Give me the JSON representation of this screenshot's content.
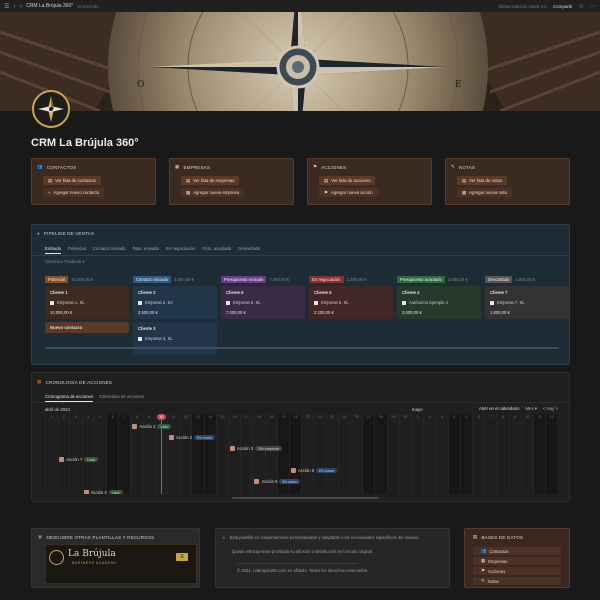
{
  "topbar": {
    "title": "CRM La Brújula 360°",
    "subtitle": "Empezada",
    "edited": "Última edición: Hace 4 h",
    "share": "Compartir"
  },
  "page": {
    "title": "CRM La Brújula 360°"
  },
  "quick": [
    {
      "title": "CONTACTOS",
      "btn1": "Ver lista de contactos",
      "btn2": "Agregar nuevo contacto",
      "icon": "contacts-icon"
    },
    {
      "title": "EMPRESAS",
      "btn1": "Ver lista de empresas",
      "btn2": "Agregar nueva empresa",
      "icon": "building-icon"
    },
    {
      "title": "ACCIONES",
      "btn1": "Ver lista de acciones",
      "btn2": "Agregar nueva acción",
      "icon": "flag-icon"
    },
    {
      "title": "NOTAS",
      "btn1": "Ver lista de notas",
      "btn2": "Agregar nueva nota",
      "icon": "note-icon"
    }
  ],
  "pipeline": {
    "title": "PIPELINE DE VENTAS",
    "tabs": [
      "Embudo",
      "Potencial",
      "Contacto iniciado",
      "Ppto. enviado",
      "En negociación",
      "Ppto. aceptado",
      "Descartado"
    ],
    "filter": "Servicio ▸ Producto ▾",
    "columns": [
      {
        "name": "Potencial",
        "amount": "10.000,00 €",
        "color": "#8a4e1f",
        "bg": "#3d2b1f",
        "cards": [
          {
            "title": "Cliente 1",
            "company": "Empresa 1, SL",
            "value": "10.000,00 €"
          }
        ],
        "new_label": "Nuevo contacto"
      },
      {
        "name": "Contacto iniciado",
        "amount": "4.500,00 €",
        "color": "#2c5b86",
        "bg": "#22364a",
        "cards": [
          {
            "title": "Cliente 2",
            "company": "Empresa 2, SA",
            "value": "2.500,00 €"
          },
          {
            "title": "Cliente 3",
            "company": "Empresa 3, SL",
            "value": ""
          }
        ]
      },
      {
        "name": "Presupuesto enviado",
        "amount": "7.000,00 €",
        "color": "#6b3a8a",
        "bg": "#3a2a45",
        "cards": [
          {
            "title": "Cliente 6",
            "company": "Empresa 6, SL",
            "value": "7.000,00 €"
          }
        ]
      },
      {
        "name": "En negociación",
        "amount": "2.200,00 €",
        "color": "#8a2d2d",
        "bg": "#432726",
        "cards": [
          {
            "title": "Cliente 5",
            "company": "Empresa 5, SL",
            "value": "2.200,00 €"
          }
        ]
      },
      {
        "name": "Presupuesto aceptado",
        "amount": "3.000,00 €",
        "color": "#2e6b3c",
        "bg": "#263a2c",
        "cards": [
          {
            "title": "Cliente 4",
            "company": "Autónomo Ejemplo 4",
            "value": "3.000,00 €"
          }
        ]
      },
      {
        "name": "Descartado",
        "amount": "1.800,00 €",
        "color": "#555555",
        "bg": "#333333",
        "cards": [
          {
            "title": "Cliente 7",
            "company": "Empresa 7, SL",
            "value": "1.800,00 €"
          }
        ]
      }
    ]
  },
  "timeline": {
    "title": "CRONOLOGÍA DE ACCIONES",
    "tabs": [
      "Cronograma de acciones",
      "Calendario de acciones"
    ],
    "month1": "abril de 2024",
    "month2": "mayo",
    "open_label": "Abrir en el calendario",
    "range": "Mes ▾",
    "nav": "< Hoy >",
    "days": [
      "1",
      "2",
      "3",
      "4",
      "5",
      "6",
      "7",
      "8",
      "9",
      "10",
      "11",
      "12",
      "13",
      "14",
      "15",
      "16",
      "17",
      "18",
      "19",
      "20",
      "21",
      "22",
      "23",
      "24",
      "25",
      "26",
      "27",
      "28",
      "29",
      "30",
      "1",
      "2",
      "3",
      "4",
      "5",
      "6",
      "7",
      "8",
      "9",
      "10",
      "11",
      "12"
    ],
    "weekend_index": [
      5,
      6,
      12,
      13,
      19,
      20,
      26,
      27,
      33,
      34,
      40,
      41
    ],
    "today_index": 9,
    "events": [
      {
        "label": "Acción 2",
        "status": "Listo",
        "kind": "listo",
        "day": 7,
        "row": 0
      },
      {
        "label": "Acción 2",
        "status": "En curso",
        "kind": "curso",
        "day": 10,
        "row": 1
      },
      {
        "label": "Acción 3",
        "status": "Sin empezar",
        "kind": "sin",
        "day": 15,
        "row": 2
      },
      {
        "label": "Acción 7",
        "status": "Listo",
        "kind": "listo",
        "day": 1,
        "row": 3
      },
      {
        "label": "Acción 6",
        "status": "En curso",
        "kind": "curso",
        "day": 20,
        "row": 4
      },
      {
        "label": "Acción 5",
        "status": "En curso",
        "kind": "curso",
        "day": 17,
        "row": 5
      },
      {
        "label": "Acción 4",
        "status": "Listo",
        "kind": "listo",
        "day": 3,
        "row": 6
      }
    ]
  },
  "bottom": {
    "discover_title": "DESCUBRE OTRAS PLANTILLAS Y RECURSOS",
    "brand": "La Brújula",
    "brand_sub": "BUSINESS ACADEMY",
    "notice1": "Esta plantilla es completamente personalizable y adaptable a las necesidades específicas del usuario.",
    "notice2": "Queda estrictamente prohibida su difusión o distribución en formato original.",
    "footer": "© 2024, LaBrujula360.com es afiliado. Todos los derechos reservados.",
    "db_title": "BASES DE DATOS",
    "db_items": [
      "Contactos",
      "Empresas",
      "Acciones",
      "Notas"
    ]
  }
}
